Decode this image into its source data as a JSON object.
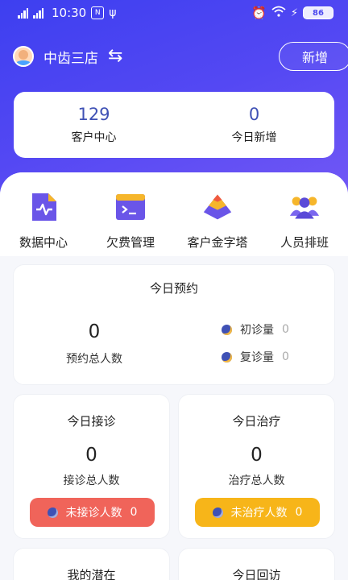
{
  "status_bar": {
    "signal1_label": "4GHD",
    "signal2_label": "4G",
    "time": "10:30",
    "nfc": "N",
    "usb": "ψ",
    "battery": "86"
  },
  "header": {
    "store_name": "中齿三店",
    "switch_symbol": "⇆",
    "new_label": "新增"
  },
  "stats": [
    {
      "value": "129",
      "label": "客户中心"
    },
    {
      "value": "0",
      "label": "今日新增"
    }
  ],
  "quick_actions": [
    {
      "label": "数据中心",
      "icon": "data-center-icon"
    },
    {
      "label": "欠费管理",
      "icon": "terminal-icon"
    },
    {
      "label": "客户金字塔",
      "icon": "pyramid-icon"
    },
    {
      "label": "人员排班",
      "icon": "people-icon"
    }
  ],
  "appointment": {
    "title": "今日预约",
    "total": "0",
    "total_label": "预约总人数",
    "first_label": "初诊量",
    "first_value": "0",
    "return_label": "复诊量",
    "return_value": "0"
  },
  "reception": {
    "title": "今日接诊",
    "total": "0",
    "total_label": "接诊总人数",
    "pending_label": "未接诊人数",
    "pending_value": "0"
  },
  "treatment": {
    "title": "今日治疗",
    "total": "0",
    "total_label": "治疗总人数",
    "pending_label": "未治疗人数",
    "pending_value": "0"
  },
  "potential": {
    "title": "我的潜在"
  },
  "followup": {
    "title": "今日回访"
  },
  "colors": {
    "primary": "#4b48ee",
    "stat_number": "#3f51b5",
    "pill_red": "#f0645a",
    "pill_yellow": "#f7b519"
  }
}
